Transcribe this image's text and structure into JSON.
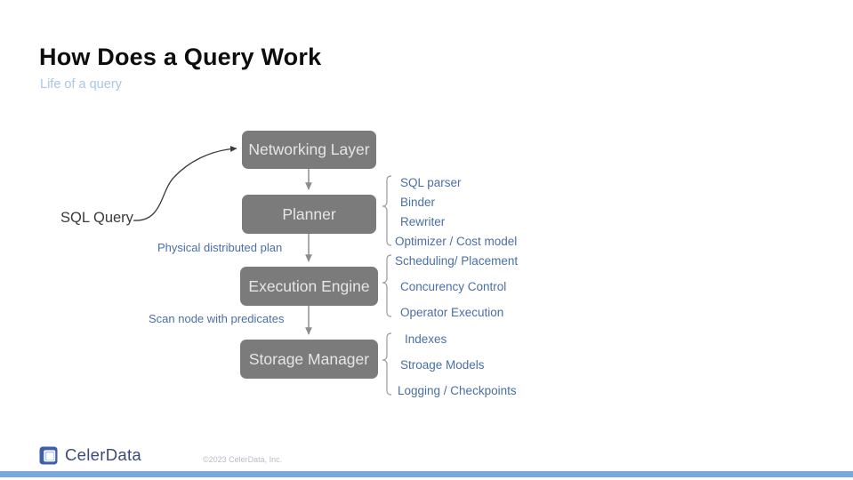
{
  "slide": {
    "title": "How Does a Query Work",
    "subtitle": "Life of a query"
  },
  "diagram": {
    "input_label": "SQL Query",
    "nodes": [
      {
        "id": "networking-layer",
        "label": "Networking Layer"
      },
      {
        "id": "planner",
        "label": "Planner"
      },
      {
        "id": "execution-engine",
        "label": "Execution Engine"
      },
      {
        "id": "storage-manager",
        "label": "Storage Manager"
      }
    ],
    "edge_labels": [
      {
        "id": "physical-distributed-plan",
        "label": "Physical distributed plan"
      },
      {
        "id": "scan-node-with-predicates",
        "label": "Scan node with predicates"
      }
    ],
    "annotations": [
      {
        "group": "planner",
        "items": [
          "SQL parser",
          "Binder",
          "Rewriter",
          "Optimizer / Cost model"
        ]
      },
      {
        "group": "execution-engine",
        "items": [
          "Scheduling/ Placement",
          "Concurency Control",
          "Operator Execution"
        ]
      },
      {
        "group": "storage-manager",
        "items": [
          "Indexes",
          "Stroage Models",
          "Logging / Checkpoints"
        ]
      }
    ]
  },
  "footer": {
    "logo_icon": "celerdata-bracket-logo-icon",
    "logo_text": "CelerData",
    "copyright": "©2023 CelerData, Inc."
  },
  "colors": {
    "box_fill": "#7b7b7b",
    "box_text": "#e6e6e6",
    "accent_blue": "#4a6fa5",
    "subtitle_blue": "#a9c6e3",
    "bottom_bar": "#79a9dc",
    "logo_blue": "#3c4a7a"
  }
}
